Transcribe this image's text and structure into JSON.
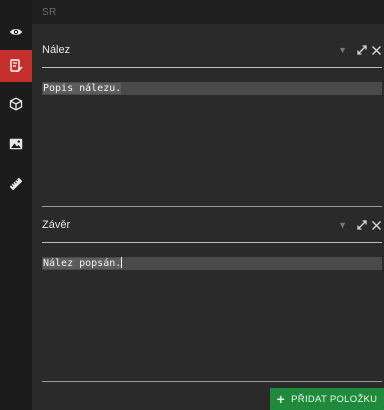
{
  "rail": {
    "items": [
      {
        "icon": "eye-icon",
        "active": false
      },
      {
        "icon": "note-edit-icon",
        "active": true
      },
      {
        "icon": "cube-icon",
        "active": false
      },
      {
        "icon": "image-icon",
        "active": false
      },
      {
        "icon": "ruler-icon",
        "active": false
      }
    ],
    "active_color": "#c4302b"
  },
  "topbar": {
    "label": "SR"
  },
  "sections": [
    {
      "title": "Nález",
      "text": "Popis nálezu."
    },
    {
      "title": "Závěr",
      "text": "Nález popsán."
    }
  ],
  "actions": {
    "add_label": "PŘIDAT POLOŽKU",
    "add_color": "#1f8a3c"
  }
}
